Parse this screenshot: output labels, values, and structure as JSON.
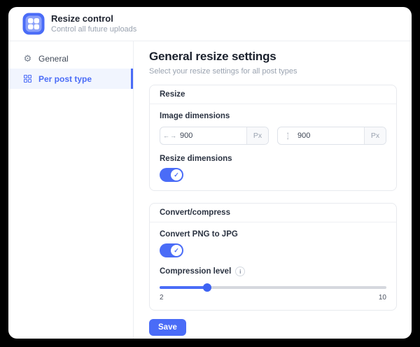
{
  "app": {
    "title": "Resize control",
    "subtitle": "Control all future uploads",
    "accent_color": "#4a6cf7"
  },
  "sidebar": {
    "items": [
      {
        "label": "General",
        "icon": "gear-icon",
        "active": false
      },
      {
        "label": "Per post type",
        "icon": "grid-icon",
        "active": true
      }
    ]
  },
  "main": {
    "title": "General resize settings",
    "subtitle": "Select your resize settings for all post types",
    "resize_card": {
      "header": "Resize",
      "image_dimensions_label": "Image dimensions",
      "width_value": "900",
      "height_value": "900",
      "unit": "Px",
      "resize_dimensions_label": "Resize dimensions",
      "resize_dimensions_on": true
    },
    "convert_card": {
      "header": "Convert/compress",
      "convert_label": "Convert PNG to JPG",
      "convert_on": true,
      "compression_label": "Compression level",
      "info_glyph": "i",
      "slider": {
        "min_label": "2",
        "max_label": "10",
        "fill_width": "21%"
      }
    },
    "save_label": "Save"
  },
  "icons": {
    "check": "✓",
    "arrow_left": "←",
    "arrow_right": "→",
    "arrow_up": "↑",
    "arrow_down": "↓",
    "gear": "⚙"
  }
}
